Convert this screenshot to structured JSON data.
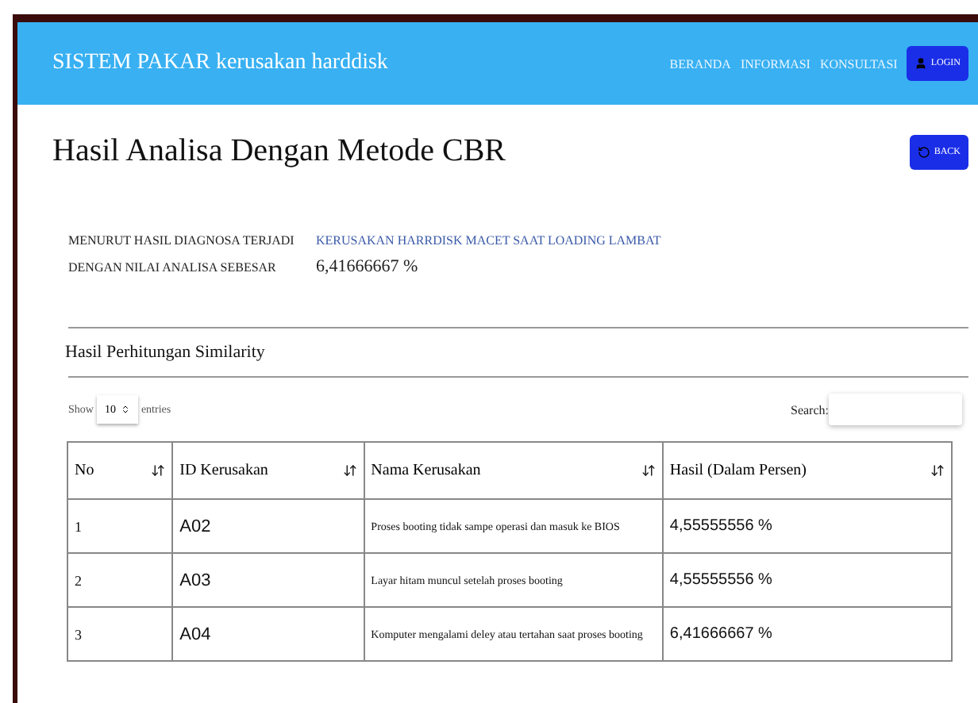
{
  "navbar": {
    "brand": "SISTEM PAKAR kerusakan harddisk",
    "links": [
      "BERANDA",
      "INFORMASI",
      "KONSULTASI"
    ],
    "login": "LOGIN"
  },
  "page": {
    "title": "Hasil Analisa Dengan Metode CBR",
    "back": "BACK"
  },
  "diagnosis": [
    {
      "label": "MENURUT HASIL DIAGNOSA TERJADI",
      "value": "KERUSAKAN  HARRDISK MACET SAAT LOADING LAMBAT",
      "kind": "link"
    },
    {
      "label": "DENGAN NILAI ANALISA SEBESAR",
      "value": "6,41666667  %",
      "kind": "plain"
    }
  ],
  "similarity": {
    "title": "Hasil Perhitungan Similarity",
    "show": "Show",
    "page_size": "10",
    "entries": "entries",
    "search_label": "Search:",
    "columns": [
      "No",
      "ID Kerusakan",
      "Nama Kerusakan",
      "Hasil (Dalam Persen)"
    ],
    "rows": [
      [
        "1",
        "A02",
        "Proses booting tidak sampe operasi dan masuk ke BIOS",
        "4,55555556 %"
      ],
      [
        "2",
        "A03",
        "Layar hitam muncul setelah proses booting",
        "4,55555556 %"
      ],
      [
        "3",
        "A04",
        "Komputer mengalami deley atau tertahan saat proses booting",
        "6,41666667  %"
      ]
    ]
  }
}
